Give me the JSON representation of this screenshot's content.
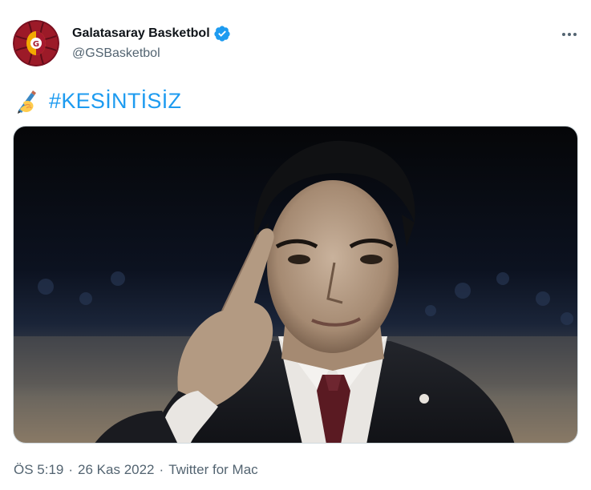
{
  "author": {
    "display_name": "Galatasaray Basketbol",
    "handle": "@GSBasketbol",
    "verified": true,
    "avatar_icon": "galatasaray-logo-icon"
  },
  "more_icon": "more-options-icon",
  "tweet": {
    "emoji_icon": "writing-hand-emoji-icon",
    "hashtag": "#KESİNTİSİZ"
  },
  "media": {
    "type": "photo"
  },
  "meta": {
    "time": "ÖS 5:19",
    "date": "26 Kas 2022",
    "source": "Twitter for Mac",
    "separator": "·"
  },
  "colors": {
    "link": "#1d9bf0",
    "secondary_text": "#536471",
    "verified": "#1d9bf0",
    "avatar_red": "#a6192e",
    "avatar_gold": "#f0a30a"
  }
}
